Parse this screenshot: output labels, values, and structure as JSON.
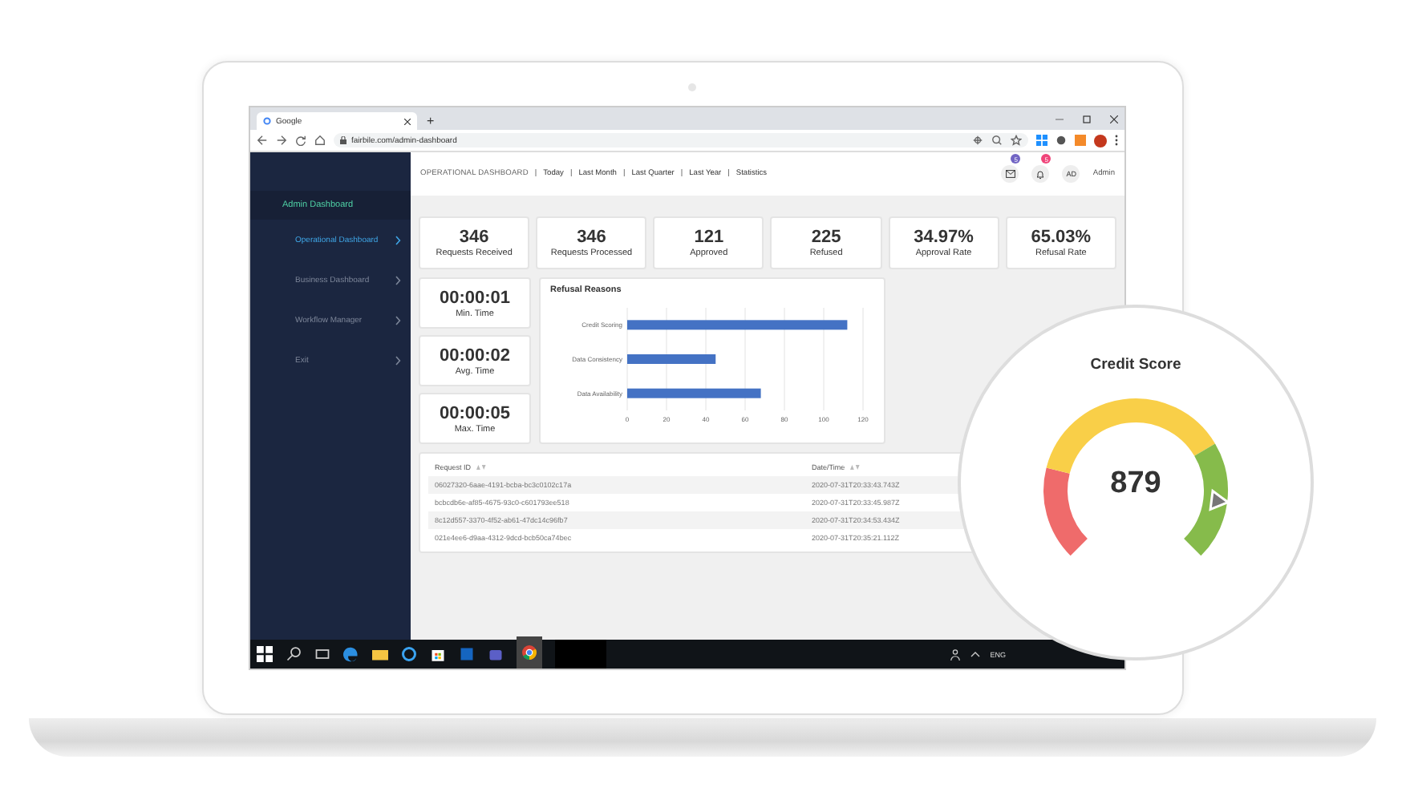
{
  "browser": {
    "tab_title": "Google",
    "new_tab": "+",
    "address": "fairbile.com/admin-dashboard"
  },
  "sidebar": {
    "title": "Admin Dashboard",
    "items": [
      {
        "label": "Operational Dashboard",
        "selected": true
      },
      {
        "label": "Business Dashboard",
        "selected": false
      },
      {
        "label": "Workflow Manager",
        "selected": false
      },
      {
        "label": "Exit",
        "selected": false
      }
    ]
  },
  "header": {
    "nav": [
      {
        "label": "OPERATIONAL DASHBOARD",
        "kind": "title"
      },
      {
        "label": "|",
        "kind": "separator"
      },
      {
        "label": "Today",
        "kind": "link"
      },
      {
        "label": "|",
        "kind": "separator"
      },
      {
        "label": "Last Month",
        "kind": "link"
      },
      {
        "label": "|",
        "kind": "separator"
      },
      {
        "label": "Last Quarter",
        "kind": "link"
      },
      {
        "label": "|",
        "kind": "separator"
      },
      {
        "label": "Last Year",
        "kind": "link"
      },
      {
        "label": "|",
        "kind": "separator"
      },
      {
        "label": "Statistics",
        "kind": "link"
      }
    ],
    "mail_badge": "5",
    "bell_badge": "5",
    "avatar": "AD",
    "user": "Admin"
  },
  "stats": [
    {
      "value": "346",
      "label": "Requests Received"
    },
    {
      "value": "346",
      "label": "Requests Processed"
    },
    {
      "value": "121",
      "label": "Approved"
    },
    {
      "value": "225",
      "label": "Refused"
    },
    {
      "value": "34.97%",
      "label": "Approval Rate"
    },
    {
      "value": "65.03%",
      "label": "Refusal Rate"
    }
  ],
  "times": [
    {
      "value": "00:00:01",
      "label": "Min. Time"
    },
    {
      "value": "00:00:02",
      "label": "Avg. Time"
    },
    {
      "value": "00:00:05",
      "label": "Max. Time"
    }
  ],
  "refusal_chart": {
    "chart_data": {
      "type": "bar",
      "orientation": "horizontal",
      "title": "Refusal Reasons",
      "categories": [
        "Credit Scoring",
        "Data Consistency",
        "Data Availability"
      ],
      "series": [
        {
          "color": "#4472c4",
          "values": [
            112,
            45,
            68
          ]
        }
      ],
      "grid": true,
      "xlim": [
        0,
        120
      ],
      "xticks": [
        0,
        20,
        40,
        60,
        80,
        100,
        120
      ]
    }
  },
  "table": {
    "columns": [
      "Request ID",
      "Date/Time"
    ],
    "rows": [
      [
        "06027320-6aae-4191-bcba-bc3c0102c17a",
        "2020-07-31T20:33:43.743Z"
      ],
      [
        "bcbcdb6e-af85-4675-93c0-c601793ee518",
        "2020-07-31T20:33:45.987Z"
      ],
      [
        "8c12d557-3370-4f52-ab61-47dc14c96fb7",
        "2020-07-31T20:34:53.434Z"
      ],
      [
        "021e4ee6-d9aa-4312-9dcd-bcb50ca74bec",
        "2020-07-31T20:35:21.112Z"
      ]
    ]
  },
  "taskbar": {
    "language": "ENG"
  },
  "credit_score": {
    "title": "Credit Score",
    "value": "879",
    "level": 0.86
  }
}
